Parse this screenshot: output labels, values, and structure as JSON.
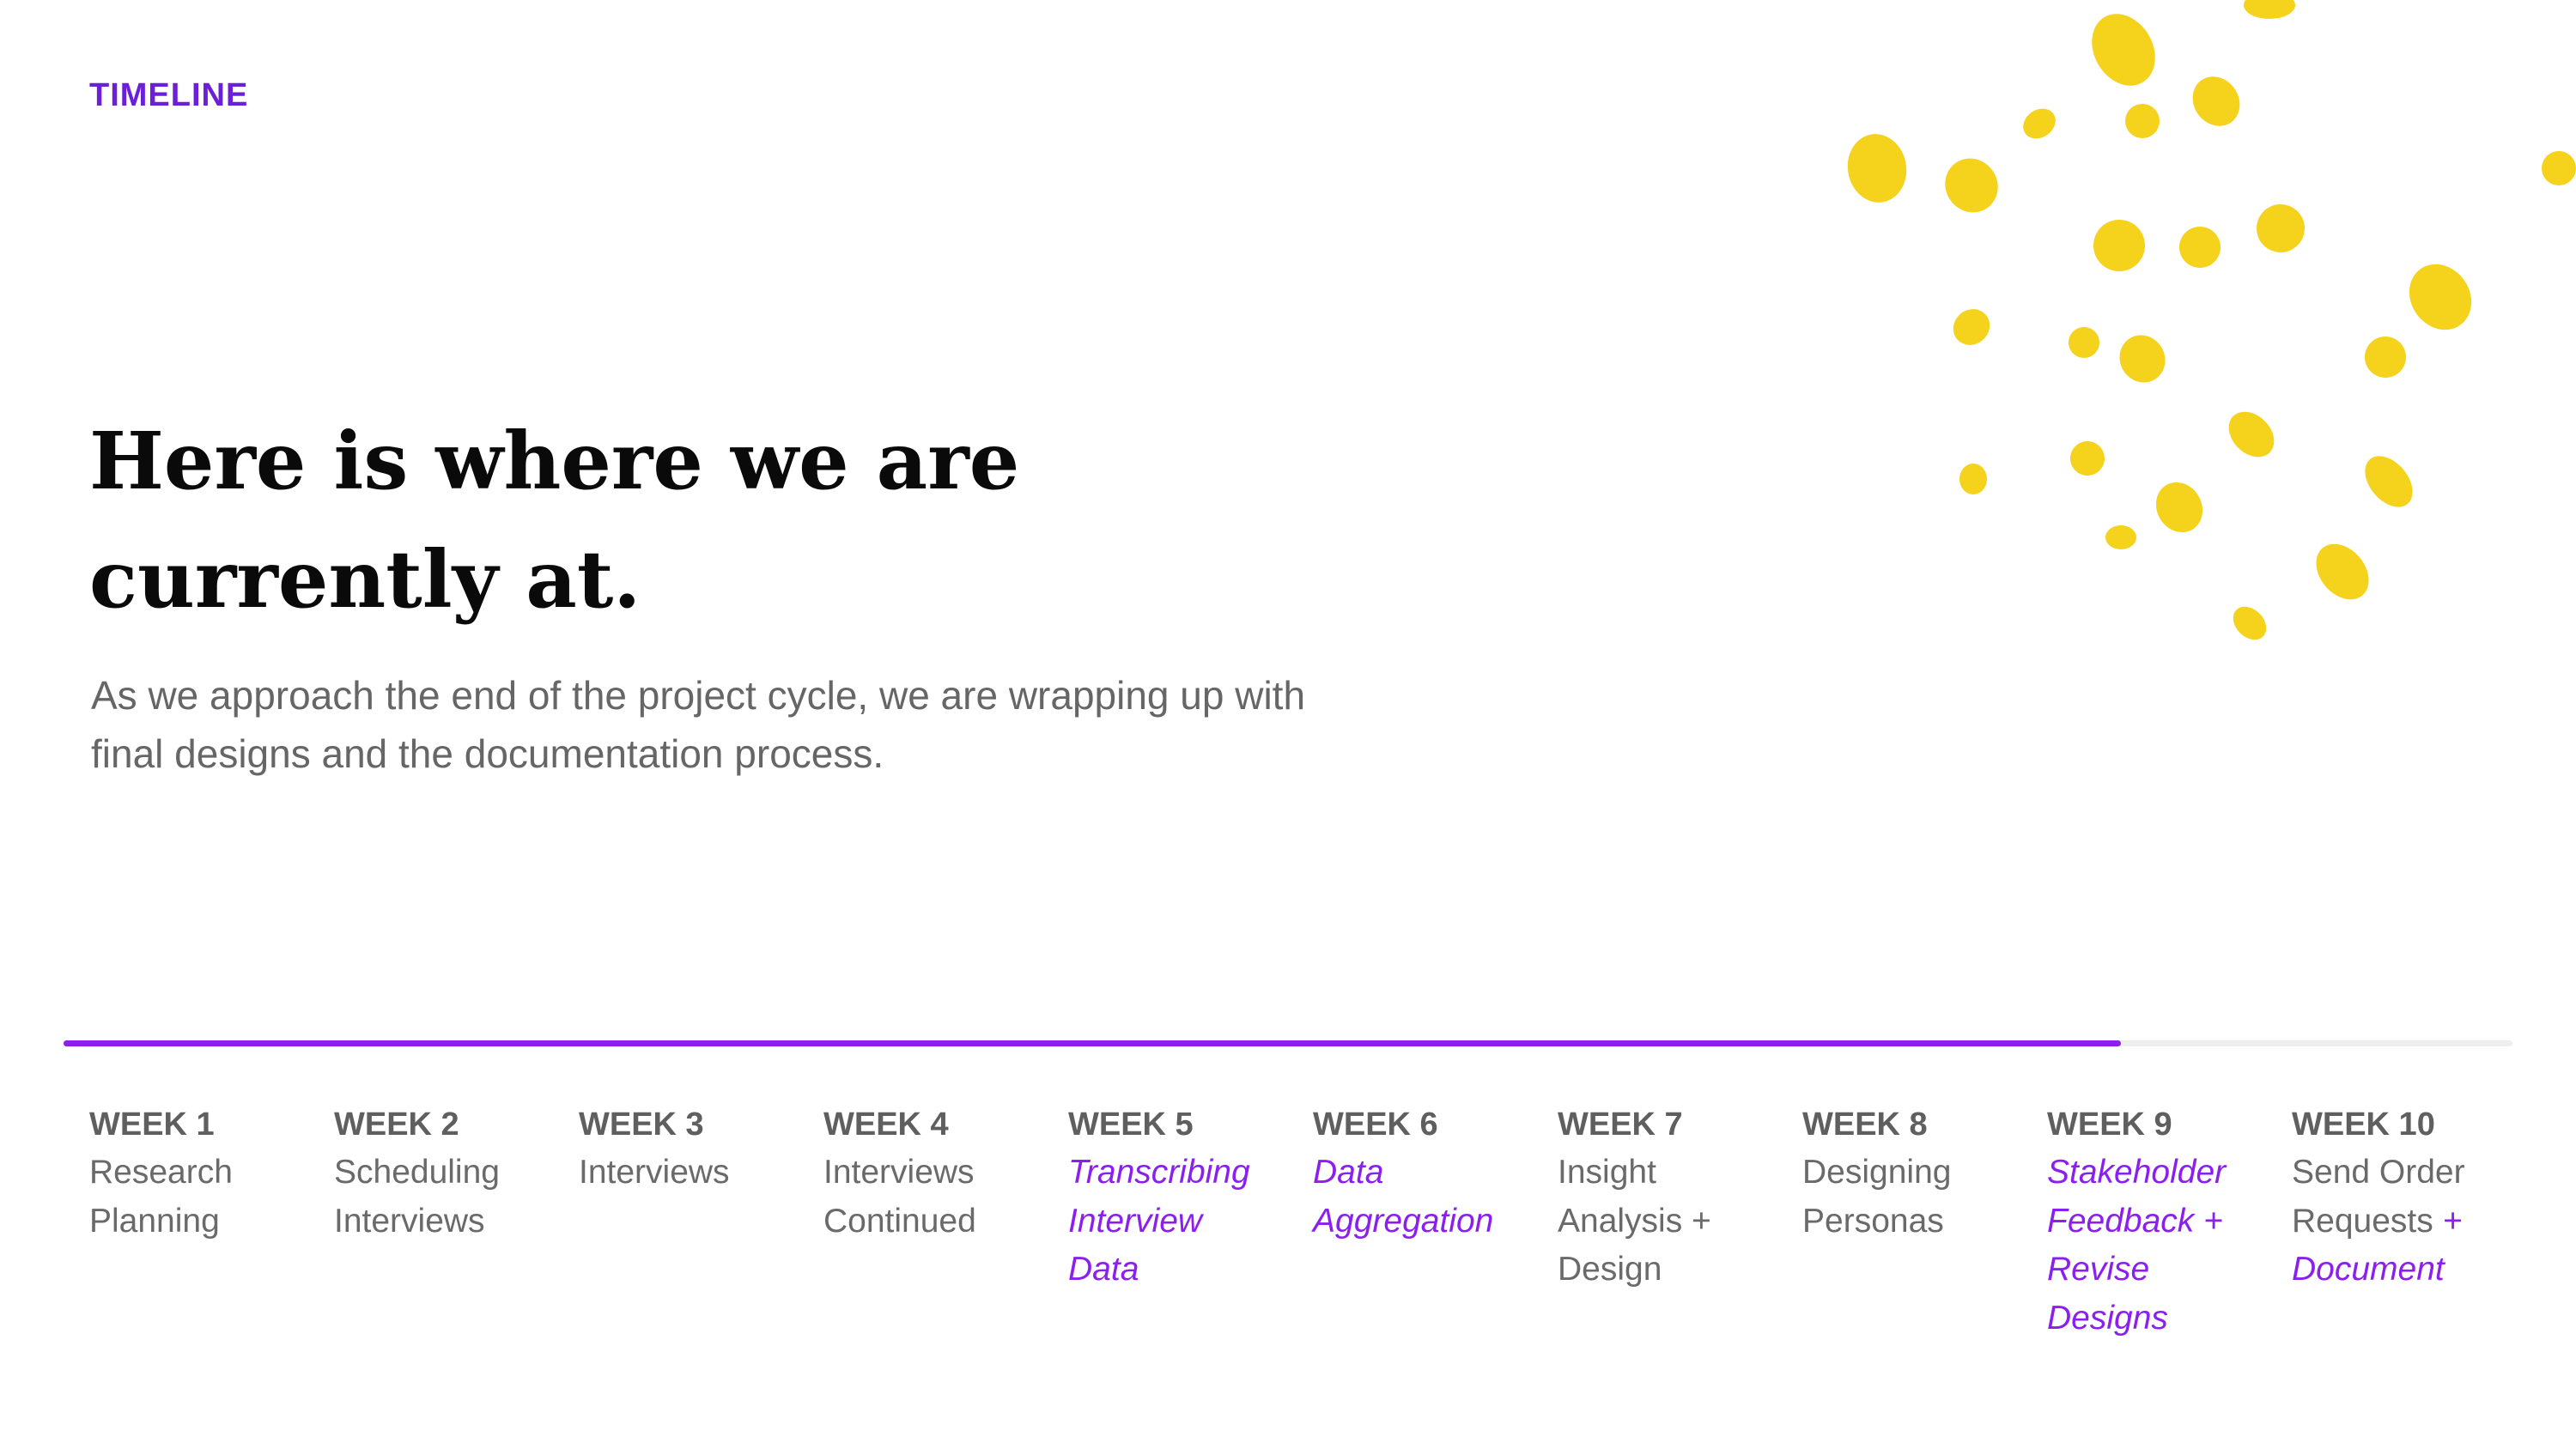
{
  "eyebrow": "TIMELINE",
  "headline": "Here is where we are currently at.",
  "subtext": "As we approach the end of the project cycle, we are wrapping up with final designs and the documentation process.",
  "colors": {
    "accent": "#8a1ff0",
    "eyebrow": "#6b1fd6",
    "decoration": "#f5d21b",
    "track": "#eeeeee"
  },
  "progress": {
    "fraction": 0.84
  },
  "weeks": [
    {
      "title": "WEEK 1",
      "task": "Research\nPlanning",
      "highlight": ""
    },
    {
      "title": "WEEK 2",
      "task": "Scheduling\nInterviews",
      "highlight": ""
    },
    {
      "title": "WEEK 3",
      "task": "Interviews",
      "highlight": ""
    },
    {
      "title": "WEEK 4",
      "task": "Interviews\nContinued",
      "highlight": ""
    },
    {
      "title": "WEEK 5",
      "task": "",
      "highlight": "Transcribing\nInterview\nData"
    },
    {
      "title": "WEEK 6",
      "task": "",
      "highlight": "Data\nAggregation"
    },
    {
      "title": "WEEK 7",
      "task": "Insight\nAnalysis +\nDesign",
      "highlight": ""
    },
    {
      "title": "WEEK 8",
      "task": "Designing\nPersonas",
      "highlight": ""
    },
    {
      "title": "WEEK 9",
      "task": "",
      "highlight": "Stakeholder\nFeedback +\nRevise\nDesigns"
    },
    {
      "title": "WEEK 10",
      "task": "Send Order\nRequests ",
      "highlight": "+\nDocument"
    }
  ]
}
